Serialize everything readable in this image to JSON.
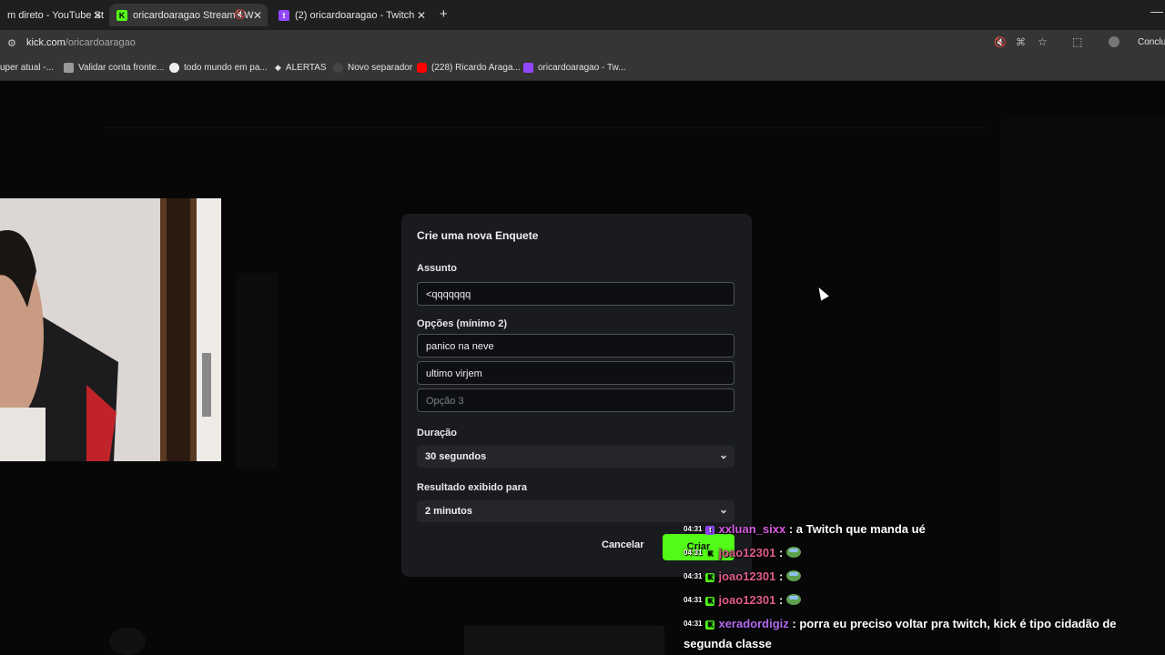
{
  "tabs": [
    {
      "label": "m direto - YouTube St",
      "icon": "youtube-studio-icon",
      "color": "#ff0000"
    },
    {
      "label": "oricardoaragao Stream - W",
      "icon": "kick-icon",
      "color": "#53fc18",
      "active": true
    },
    {
      "label": "(2) oricardoaragao - Twitch",
      "icon": "twitch-icon",
      "color": "#9146ff"
    }
  ],
  "browser": {
    "url_host": "kick.com",
    "url_path": "/oricardoaragao",
    "profile_label": "Conclui"
  },
  "bookmarks": [
    {
      "label": "uper atual -..."
    },
    {
      "label": "Validar conta fronte..."
    },
    {
      "label": "todo mundo em pa..."
    },
    {
      "label": "ALERTAS"
    },
    {
      "label": "Novo separador"
    },
    {
      "label": "(228) Ricardo Araga..."
    },
    {
      "label": "oricardoaragao - Tw..."
    }
  ],
  "modal": {
    "title": "Crie uma nova Enquete",
    "subject_label": "Assunto",
    "subject_value": "<qqqqqqq",
    "options_label": "Opções (mínimo 2)",
    "options": [
      {
        "value": "panico na neve",
        "placeholder": ""
      },
      {
        "value": "ultimo virjem",
        "placeholder": ""
      },
      {
        "value": "",
        "placeholder": "Opção 3"
      }
    ],
    "duration_label": "Duração",
    "duration_value": "30 segundos",
    "result_label": "Resultado exibido para",
    "result_value": "2 minutos",
    "cancel_label": "Cancelar",
    "create_label": "Criar"
  },
  "chat_overlay": [
    {
      "time": "04:31",
      "platform": "twitch",
      "user": "xxluan_sixx",
      "user_color": "#d65ce0",
      "message": ": a Twitch que manda ué",
      "emote": false
    },
    {
      "time": "04:31",
      "platform": "kick",
      "user": "joao12301",
      "user_color": "#e05c8a",
      "message": ":",
      "emote": true
    },
    {
      "time": "04:31",
      "platform": "kick",
      "user": "joao12301",
      "user_color": "#e05c8a",
      "message": ":",
      "emote": true
    },
    {
      "time": "04:31",
      "platform": "kick",
      "user": "joao12301",
      "user_color": "#e05c8a",
      "message": ":",
      "emote": true
    },
    {
      "time": "04:31",
      "platform": "kick",
      "user": "xeradordigiz",
      "user_color": "#b36af0",
      "message": ": porra eu preciso voltar pra twitch, kick é tipo cidadão de",
      "emote": false
    }
  ],
  "chat_overlay_wrap": "segunda classe"
}
